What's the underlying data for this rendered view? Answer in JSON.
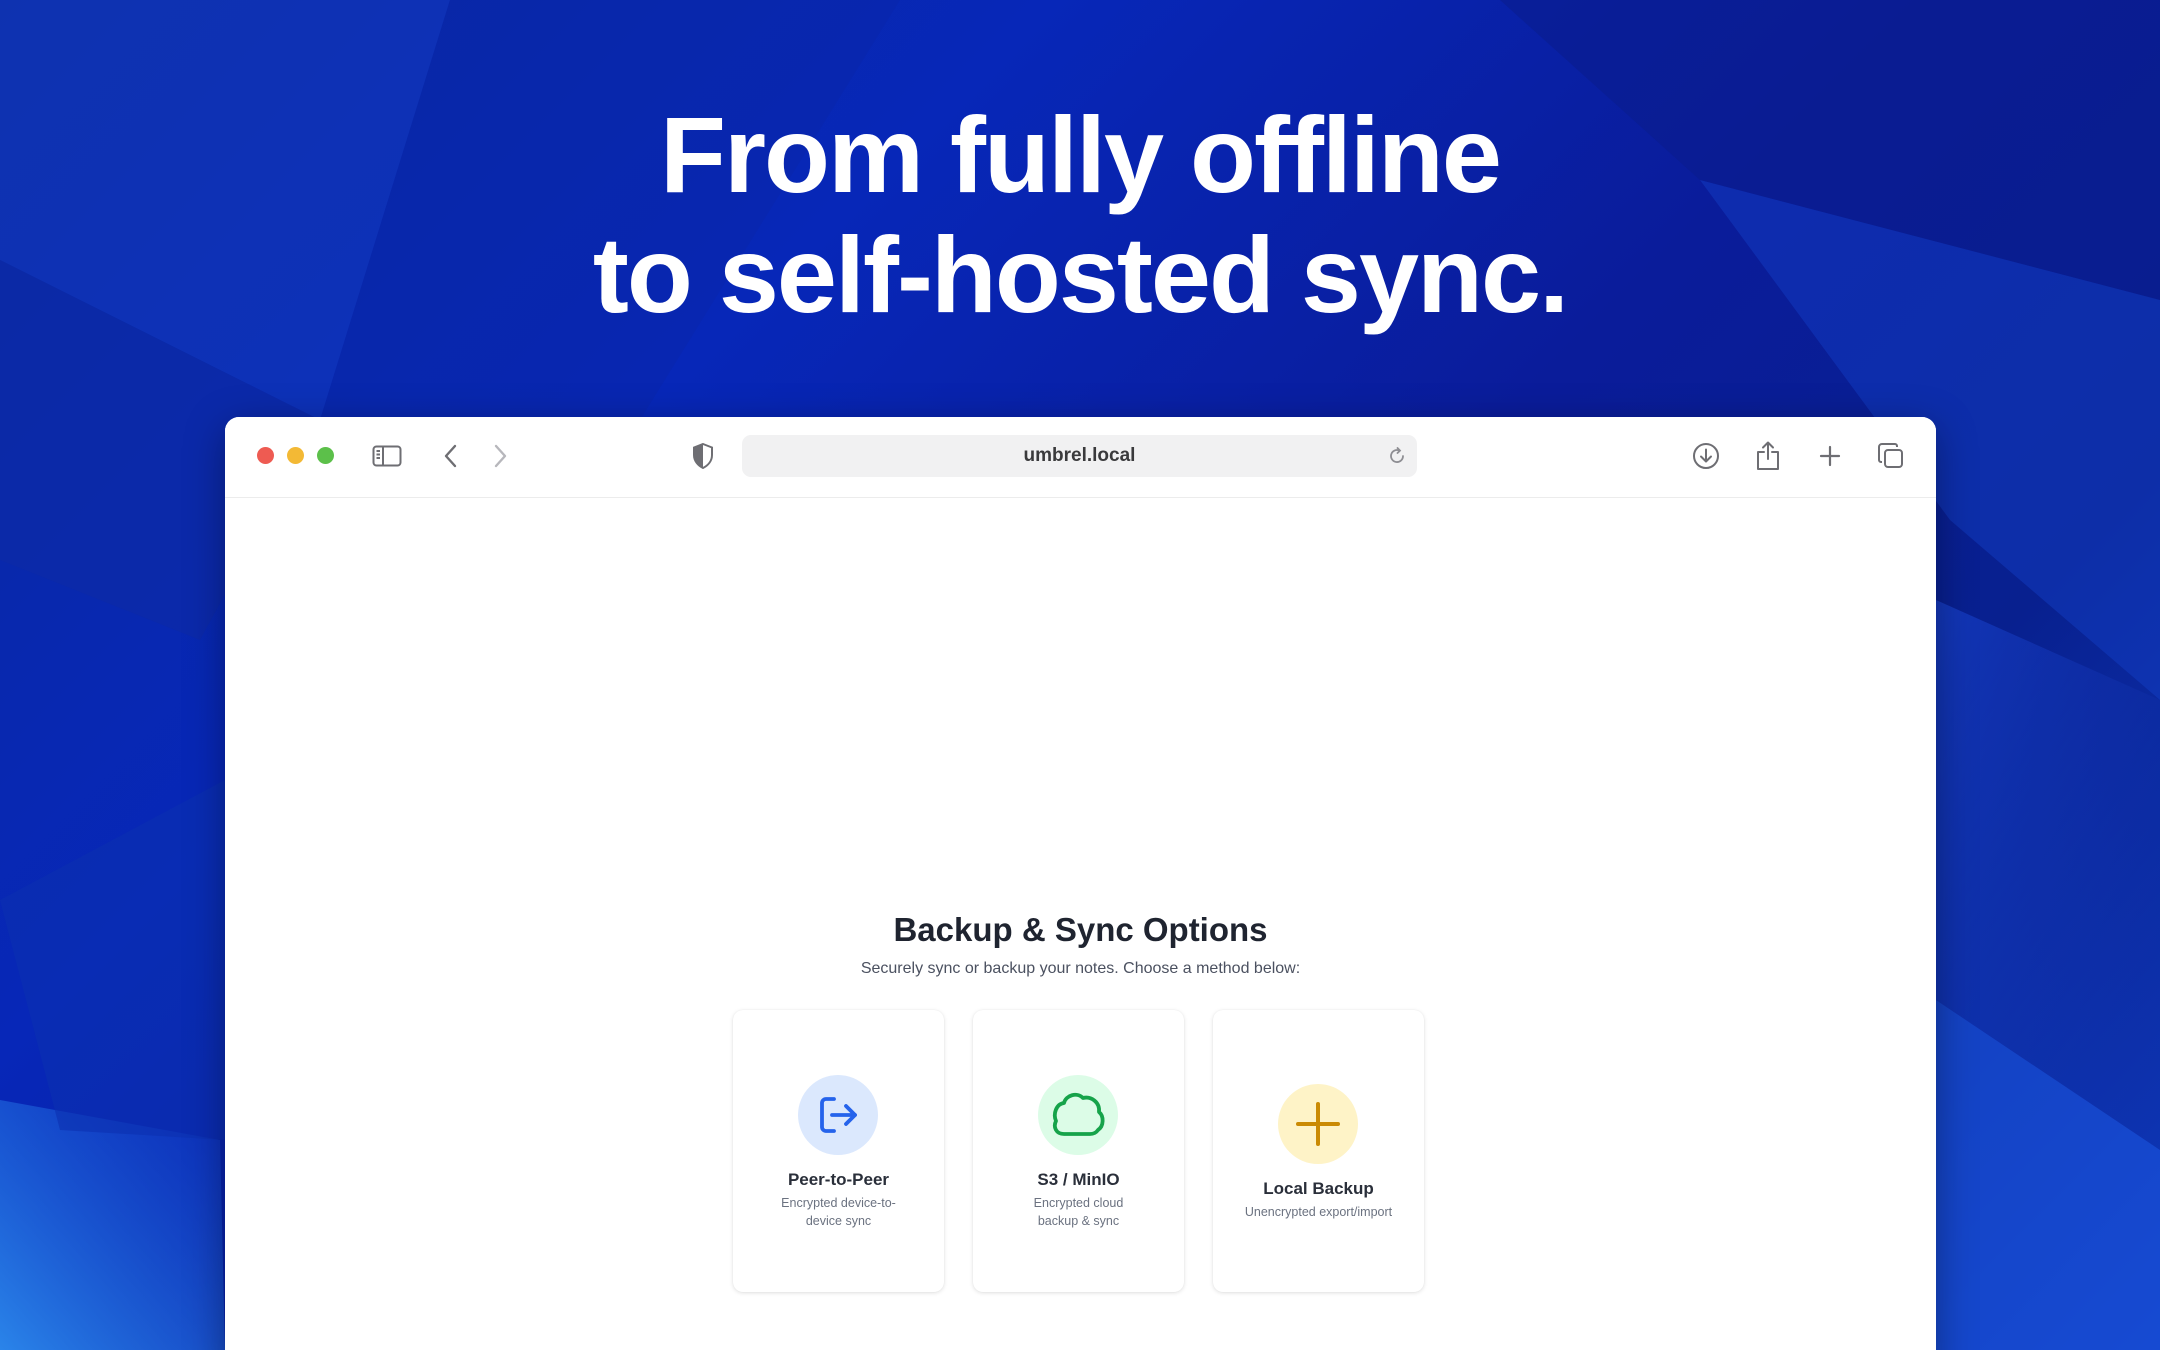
{
  "hero": {
    "line1": "From fully offline",
    "line2": "to self-hosted sync."
  },
  "browser": {
    "url": "umbrel.local",
    "icons": {
      "sidebar": "sidebar-icon",
      "back": "chevron-left-icon",
      "forward": "chevron-right-icon",
      "privacy": "shield-icon",
      "reload": "reload-icon",
      "download": "download-icon",
      "share": "share-icon",
      "new_tab": "plus-icon",
      "tabs": "tabs-overview-icon"
    }
  },
  "page": {
    "title": "Backup & Sync Options",
    "subtitle": "Securely sync or backup your notes. Choose a method below:",
    "options": [
      {
        "title": "Peer-to-Peer",
        "description": "Encrypted device-to-device sync",
        "icon": "sign-in-arrow-icon",
        "accent": "#2563eb",
        "icon_bg": "#dbe8fd"
      },
      {
        "title": "S3 / MinIO",
        "description": "Encrypted cloud backup & sync",
        "icon": "cloud-icon",
        "accent": "#16a34a",
        "icon_bg": "#dcfce7"
      },
      {
        "title": "Local Backup",
        "description": "Unencrypted export/import",
        "icon": "plus-icon",
        "accent": "#ca8a04",
        "icon_bg": "#fef3c7"
      }
    ]
  },
  "colors": {
    "background": "#0727b8",
    "traffic_red": "#ee5b52",
    "traffic_yellow": "#f3b935",
    "traffic_green": "#5cc04a"
  }
}
